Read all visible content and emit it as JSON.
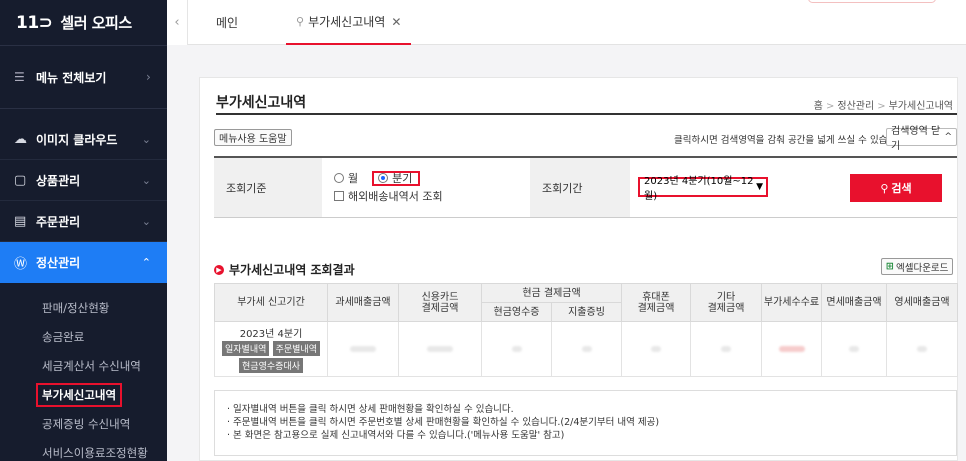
{
  "app": {
    "logo_mark": "11⊃",
    "name": "셀러 오피스"
  },
  "sidebar": {
    "menu_all": "메뉴 전체보기",
    "items": [
      {
        "label": "이미지 클라우드",
        "icon": "cloud-icon"
      },
      {
        "label": "상품관리",
        "icon": "box-icon"
      },
      {
        "label": "주문관리",
        "icon": "order-icon"
      },
      {
        "label": "정산관리",
        "icon": "won-icon"
      }
    ],
    "submenu": [
      "판매/정산현황",
      "송금완료",
      "세금계산서 수신내역",
      "부가세신고내역",
      "공제증빙 수신내역",
      "서비스이용료조정현황"
    ]
  },
  "tabs": {
    "main": "메인",
    "active": "부가세신고내역"
  },
  "page": {
    "title": "부가세신고내역",
    "breadcrumb": [
      "홈",
      "정산관리",
      "부가세신고내역"
    ],
    "help_button": "메뉴사용 도움말",
    "search_note": "클릭하시면 검색영역을 감춰 공간을 넓게 쓰실 수 있습니다.",
    "close_search": "검색영역 닫기"
  },
  "criteria": {
    "label_basis": "조회기준",
    "radio_month": "월",
    "radio_quarter": "분기",
    "overseas_check": "해외배송내역서 조회",
    "label_period": "조회기간",
    "period_value": "2023년 4분기(10월~12월)",
    "search_button": "검색"
  },
  "results": {
    "title": "부가세신고내역 조회결과",
    "excel_button": "엑셀다운로드",
    "headers": {
      "period": "부가세 신고기간",
      "taxable": "과세매출금액",
      "card": [
        "신용카드",
        "결제금액"
      ],
      "cash_group": "현금 결제금액",
      "cash_receipt": "현금영수증",
      "expense_proof": "지출증빙",
      "mobile": [
        "휴대폰",
        "결제금액"
      ],
      "other": [
        "기타",
        "결제금액"
      ],
      "vat_fee": "부가세수수료",
      "exempt": "면세매출금액",
      "zero": "영세매출금액"
    },
    "row": {
      "period": "2023년 4분기",
      "tags": [
        "일자별내역",
        "주문별내역",
        "현금영수증대사"
      ]
    }
  },
  "notes": [
    "· 일자별내역 버튼을 클릭 하시면 상세 판매현황을 확인하실 수 있습니다.",
    "· 주문별내역 버튼을 클릭 하시면 주문번호별 상세 판매현황을 확인하실 수 있습니다.(2/4분기부터 내역 제공)",
    "· 본 화면은 참고용으로 실제 신고내역서와 다를 수 있습니다.('메뉴사용 도움말' 참고)"
  ]
}
